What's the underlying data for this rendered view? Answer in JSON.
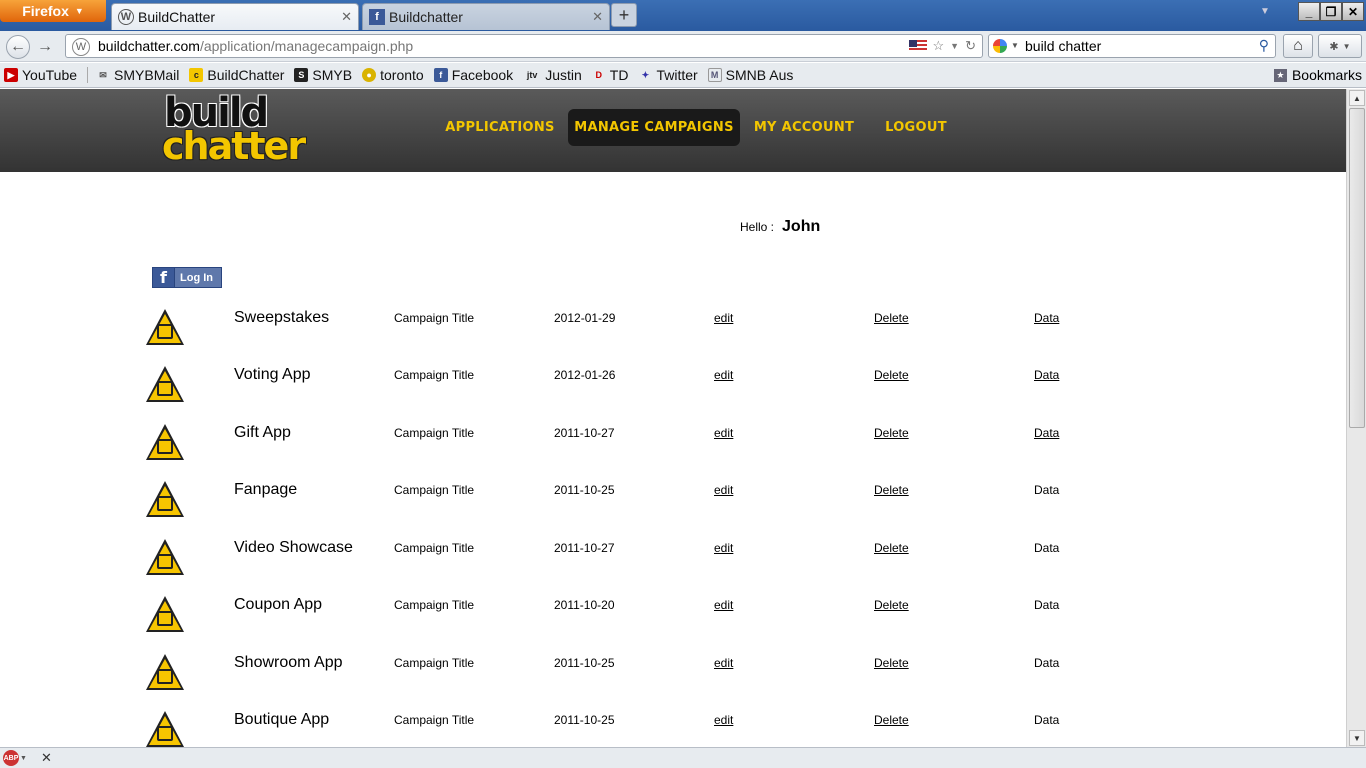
{
  "browser": {
    "menu_button": "Firefox",
    "tabs": [
      {
        "title": "BuildChatter"
      },
      {
        "title": "Buildchatter"
      }
    ],
    "url": {
      "domain": "buildchatter.com",
      "path": "/application/managecampaign.php"
    },
    "search": {
      "value": "build chatter"
    },
    "bookmarks": [
      {
        "label": "YouTube",
        "icon": "youtube-icon"
      },
      {
        "label": "SMYBMail",
        "icon": "mail-icon"
      },
      {
        "label": "BuildChatter",
        "icon": "buildchatter-icon"
      },
      {
        "label": "SMYB",
        "icon": "smyb-icon"
      },
      {
        "label": "toronto",
        "icon": "toronto-icon"
      },
      {
        "label": "Facebook",
        "icon": "facebook-icon"
      },
      {
        "label": "Justin",
        "icon": "justin-icon"
      },
      {
        "label": "TD",
        "icon": "td-icon"
      },
      {
        "label": "Twitter",
        "icon": "twitter-icon"
      },
      {
        "label": "SMNB Aus",
        "icon": "smnb-icon"
      }
    ],
    "bookmarks_menu": "Bookmarks"
  },
  "site": {
    "logo": {
      "line1": "build",
      "line2": "chatter"
    },
    "nav": [
      {
        "label": "APPLICATIONS",
        "active": false
      },
      {
        "label": "MANAGE CAMPAIGNS",
        "active": true
      },
      {
        "label": "MY ACCOUNT",
        "active": false
      },
      {
        "label": "LOGOUT",
        "active": false
      }
    ],
    "hello_label": "Hello :",
    "user_name": "John",
    "fb_login": "Log In",
    "campaigns": [
      {
        "app": "Sweepstakes",
        "title": "Campaign Title",
        "date": "2012-01-29",
        "edit": "edit",
        "delete": "Delete",
        "data": "Data",
        "data_link": true
      },
      {
        "app": "Voting App",
        "title": "Campaign Title",
        "date": "2012-01-26",
        "edit": "edit",
        "delete": "Delete",
        "data": "Data",
        "data_link": true
      },
      {
        "app": "Gift App",
        "title": "Campaign Title",
        "date": "2011-10-27",
        "edit": "edit",
        "delete": "Delete",
        "data": "Data",
        "data_link": true
      },
      {
        "app": "Fanpage",
        "title": "Campaign Title",
        "date": "2011-10-25",
        "edit": "edit",
        "delete": "Delete",
        "data": "Data",
        "data_link": false
      },
      {
        "app": "Video Showcase",
        "title": "Campaign Title",
        "date": "2011-10-27",
        "edit": "edit",
        "delete": "Delete",
        "data": "Data",
        "data_link": false
      },
      {
        "app": "Coupon App",
        "title": "Campaign Title",
        "date": "2011-10-20",
        "edit": "edit",
        "delete": "Delete",
        "data": "Data",
        "data_link": false
      },
      {
        "app": "Showroom App",
        "title": "Campaign Title",
        "date": "2011-10-25",
        "edit": "edit",
        "delete": "Delete",
        "data": "Data",
        "data_link": false
      },
      {
        "app": "Boutique App",
        "title": "Campaign Title",
        "date": "2011-10-25",
        "edit": "edit",
        "delete": "Delete",
        "data": "Data",
        "data_link": false
      }
    ]
  },
  "colors": {
    "accent": "#f3c600",
    "header_bg": "#444444",
    "fb_blue": "#3b5998"
  }
}
